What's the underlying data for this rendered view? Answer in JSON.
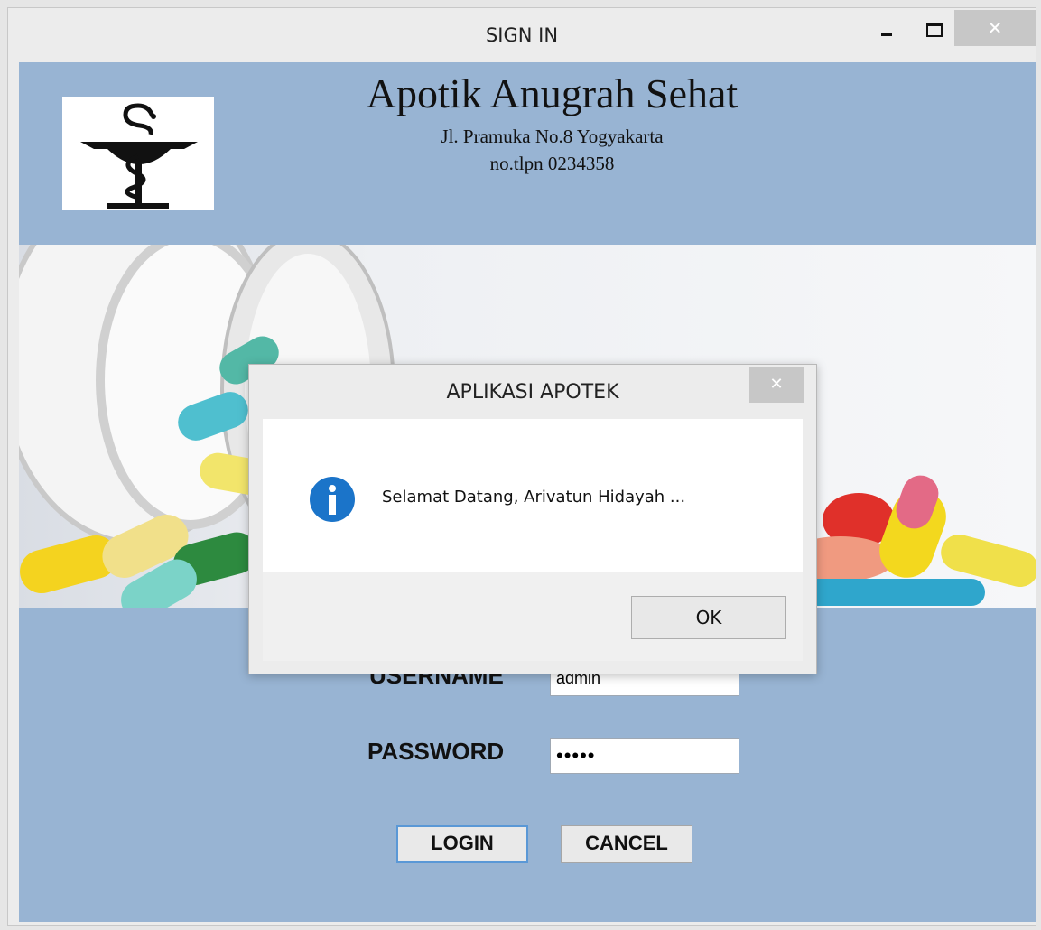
{
  "window": {
    "title": "SIGN IN",
    "minimize_icon": "minimize-icon",
    "maximize_icon": "maximize-icon",
    "close_label": "✕"
  },
  "header": {
    "store_name": "Apotik Anugrah Sehat",
    "address": "Jl. Pramuka No.8 Yogyakarta",
    "phone": "no.tlpn 0234358",
    "logo_icon": "caduceus-icon"
  },
  "banner": {
    "image": "pills-bottle-banner"
  },
  "form": {
    "username_label": "USERNAME",
    "username_value": "admin",
    "password_label": "PASSWORD",
    "password_value": "•••••",
    "login_label": "LOGIN",
    "cancel_label": "CANCEL"
  },
  "dialog": {
    "title": "APLIKASI APOTEK",
    "close_label": "✕",
    "icon": "info-icon",
    "message": "Selamat Datang, Arivatun Hidayah ...",
    "ok_label": "OK"
  },
  "colors": {
    "header_bg": "#98b4d3",
    "info_blue": "#1b74c9",
    "login_border": "#5a98d6"
  }
}
